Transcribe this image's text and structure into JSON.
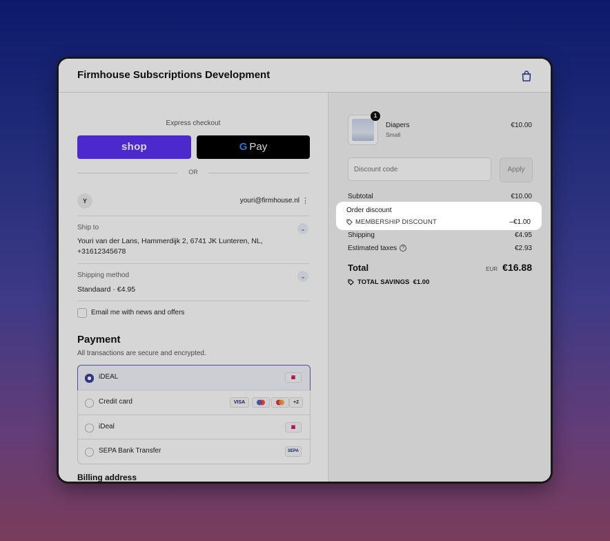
{
  "header": {
    "store_name": "Firmhouse Subscriptions Development"
  },
  "express": {
    "label": "Express checkout",
    "shop_label": "shop",
    "gpay_g": "G",
    "gpay_label": "Pay",
    "or_text": "OR"
  },
  "account": {
    "avatar": "Y",
    "email": "youri@firmhouse.nl"
  },
  "ship_to": {
    "label": "Ship to",
    "line1": "Youri van der Lans, Hammerdijk 2, 6741 JK Lunteren, NL,",
    "line2": "+31612345678"
  },
  "shipping_method": {
    "label": "Shipping method",
    "value": "Standaard · €4.95"
  },
  "newsletter": {
    "label": "Email me with news and offers"
  },
  "payment": {
    "title": "Payment",
    "subtitle": "All transactions are secure and encrypted.",
    "options": [
      {
        "label": "iDEAL",
        "selected": true
      },
      {
        "label": "Credit card",
        "selected": false
      },
      {
        "label": "iDeal",
        "selected": false
      },
      {
        "label": "SEPA Bank Transfer",
        "selected": false
      }
    ],
    "card_logos": [
      "VISA",
      "+2"
    ],
    "sepa_logo": "SEPA"
  },
  "billing": {
    "title": "Billing address"
  },
  "summary": {
    "product": {
      "quantity": "1",
      "name": "Diapers",
      "variant": "Small",
      "price": "€10.00"
    },
    "discount_placeholder": "Discount code",
    "apply_label": "Apply",
    "subtotal": {
      "label": "Subtotal",
      "value": "€10.00"
    },
    "order_discount": {
      "label": "Order discount",
      "code": "MEMBERSHIP DISCOUNT",
      "value": "–€1.00"
    },
    "shipping": {
      "label": "Shipping",
      "value": "€4.95"
    },
    "taxes": {
      "label": "Estimated taxes",
      "value": "€2.93"
    },
    "total": {
      "label": "Total",
      "currency": "EUR",
      "value": "€16.88"
    },
    "savings": {
      "label": "TOTAL SAVINGS",
      "value": "€1.00"
    }
  },
  "colors": {
    "shop_pay": "#5a31f4",
    "accent": "#3c3ea3"
  }
}
